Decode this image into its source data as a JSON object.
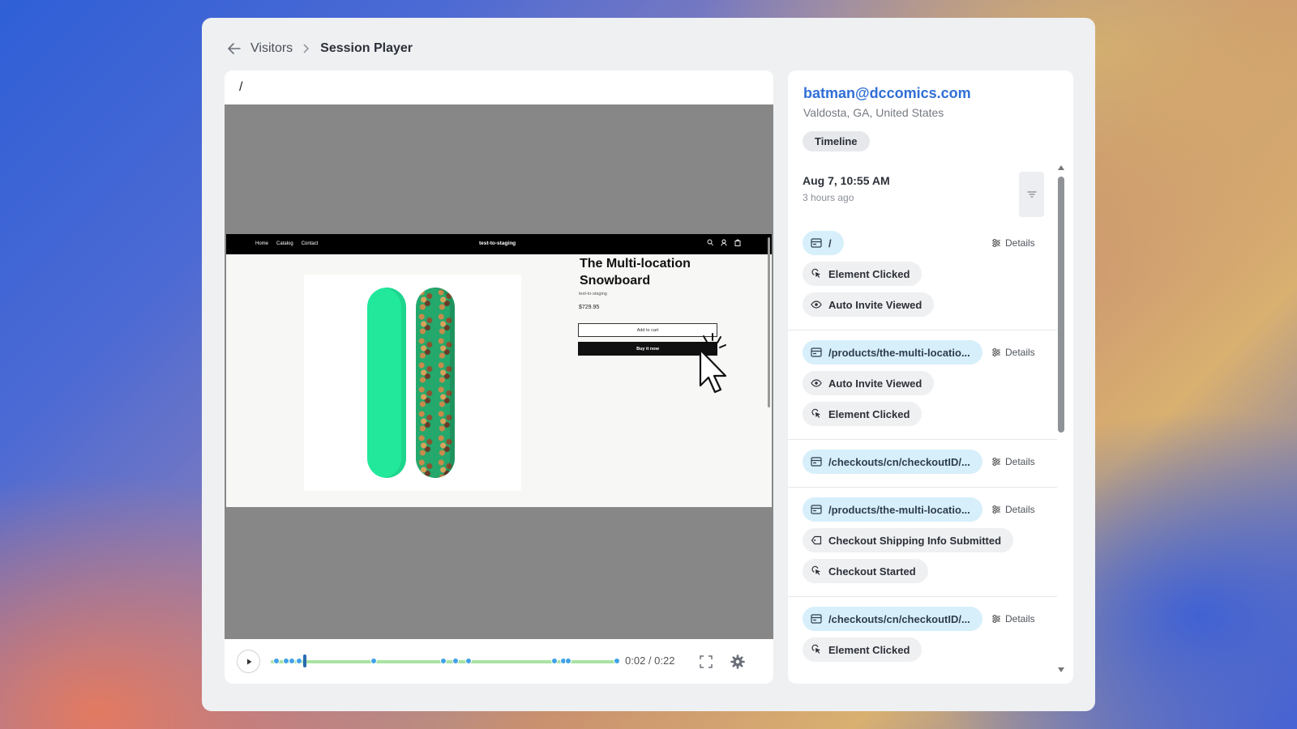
{
  "breadcrumb": {
    "parent": "Visitors",
    "current": "Session Player"
  },
  "player": {
    "url": "/",
    "time": "0:02 / 0:22",
    "progress_fraction": 0.09,
    "site": {
      "nav_links": [
        "Home",
        "Catalog",
        "Contact"
      ],
      "brand": "test-to-staging",
      "product_title": "The Multi-location Snowboard",
      "vendor": "test-to-staging",
      "price": "$729.95",
      "add_to_cart": "Add to cart",
      "buy_now": "Buy it now"
    }
  },
  "visitor": {
    "email": "batman@dccomics.com",
    "location": "Valdosta, GA, United States"
  },
  "tabs": {
    "timeline": "Timeline"
  },
  "session": {
    "date": "Aug 7, 10:55 AM",
    "ago": "3 hours ago"
  },
  "details_label": "Details",
  "timeline": [
    {
      "page": "/",
      "events": [
        {
          "icon": "click-icon",
          "label": "Element Clicked"
        },
        {
          "icon": "eye-icon",
          "label": "Auto Invite Viewed"
        }
      ]
    },
    {
      "page": "/products/the-multi-locatio...",
      "events": [
        {
          "icon": "eye-icon",
          "label": "Auto Invite Viewed"
        },
        {
          "icon": "click-icon",
          "label": "Element Clicked"
        }
      ]
    },
    {
      "page": "/checkouts/cn/checkoutID/...",
      "events": []
    },
    {
      "page": "/products/the-multi-locatio...",
      "events": [
        {
          "icon": "tag-icon",
          "label": "Checkout Shipping Info Submitted"
        },
        {
          "icon": "click-icon",
          "label": "Checkout Started"
        }
      ]
    },
    {
      "page": "/checkouts/cn/checkoutID/...",
      "events": [
        {
          "icon": "click-icon",
          "label": "Element Clicked"
        }
      ]
    }
  ],
  "colors": {
    "accent": "#2f6fd6",
    "page_pill": "#d7effb",
    "event_pill": "#eff0f2",
    "progress": "#a9e3a2",
    "marker": "#3fa2e8"
  }
}
